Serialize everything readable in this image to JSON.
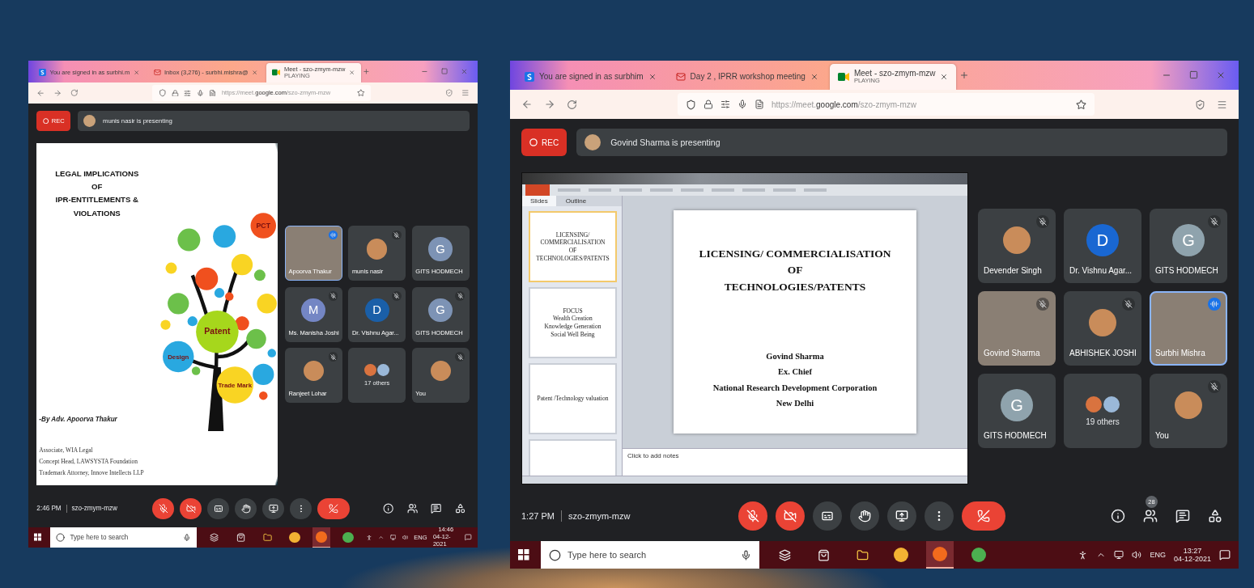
{
  "windows": [
    {
      "tabs": [
        {
          "kind": "s",
          "label": "You are signed in as surbhi.m",
          "selected": false
        },
        {
          "kind": "mail",
          "label": "Inbox (3,276) - surbhi.mishra@",
          "selected": false
        },
        {
          "kind": "meet",
          "label": "Meet - szo-zmym-mzw",
          "sub": "PLAYING",
          "selected": true
        }
      ],
      "url": {
        "prefix": "https://meet.",
        "domain": "google.com",
        "path": "/szo-zmym-mzw"
      },
      "rec": "REC",
      "presenter": "munis nasir is presenting",
      "presentation": {
        "kind": "legal_slide",
        "title": [
          "LEGAL IMPLICATIONS",
          "OF",
          "IPR-ENTITLEMENTS & VIOLATIONS"
        ],
        "byline": "-By Adv. Apoorva Thakur",
        "roles": [
          "Associate, WIA Legal",
          "Concept Head, LAWSYSTA Foundation",
          "Trademark Attorney, Innove Intellects LLP"
        ],
        "bubbles": [
          {
            "label": "Patent",
            "color": "#a6d71c"
          },
          {
            "label": "Design",
            "color": "#29a8e0"
          },
          {
            "label": "Trade Mark",
            "color": "#f9d423"
          },
          {
            "label": "PCT",
            "color": "#f0501e"
          }
        ]
      },
      "tiles": [
        {
          "kind": "video",
          "name": "Apoorva Thakur",
          "muted": false,
          "speaking": true,
          "highlighted": true
        },
        {
          "kind": "avatar",
          "name": "munis nasir",
          "muted": true,
          "speaking": false,
          "highlighted": false
        },
        {
          "kind": "initial",
          "initial": "G",
          "color": "#7d93b5",
          "name": "GITS HODMECH",
          "muted": false,
          "speaking": false,
          "highlighted": false
        },
        {
          "kind": "initial",
          "initial": "M",
          "color": "#7486c4",
          "name": "Ms. Manisha Joshi",
          "muted": true,
          "speaking": false,
          "highlighted": false
        },
        {
          "kind": "initial",
          "initial": "D",
          "color": "#1a5fa8",
          "name": "Dr. Vishnu Agar...",
          "muted": true,
          "speaking": false,
          "highlighted": false
        },
        {
          "kind": "initial",
          "initial": "G",
          "color": "#7d93b5",
          "name": "GITS HODMECH",
          "muted": true,
          "speaking": false,
          "highlighted": false
        },
        {
          "kind": "avatar",
          "name": "Ranjeet Lohar",
          "muted": true,
          "speaking": false,
          "highlighted": false
        },
        {
          "kind": "others",
          "name": "17 others",
          "muted": false,
          "speaking": false,
          "highlighted": false
        },
        {
          "kind": "avatar",
          "name": "You",
          "muted": true,
          "speaking": false,
          "highlighted": false
        }
      ],
      "time": "2:46 PM",
      "code": "szo-zmym-mzw",
      "controls": {
        "mic_on": false,
        "camera_on": false
      },
      "taskbar": {
        "placeholder": "Type here to search",
        "lang": "ENG",
        "time": "14:46",
        "date": "04-12-2021"
      }
    },
    {
      "tabs": [
        {
          "kind": "s",
          "label": "You are signed in as surbhim",
          "selected": false
        },
        {
          "kind": "mail",
          "label": "Day 2 , IPRR workshop meeting",
          "selected": false
        },
        {
          "kind": "meet",
          "label": "Meet - szo-zmym-mzw",
          "sub": "PLAYING",
          "selected": true
        }
      ],
      "url": {
        "prefix": "https://meet.",
        "domain": "google.com",
        "path": "/szo-zmym-mzw"
      },
      "rec": "REC",
      "presenter": "Govind Sharma is presenting",
      "presentation": {
        "kind": "powerpoint",
        "panel_tabs": [
          {
            "label": "Slides",
            "selected": true
          },
          {
            "label": "Outline",
            "selected": false
          }
        ],
        "thumbnails": [
          {
            "lines": [
              "LICENSING/ COMMERCIALISATION",
              "OF",
              "TECHNOLOGIES/PATENTS"
            ],
            "selected": true
          },
          {
            "lines": [
              "FOCUS",
              "Wealth Creation",
              "Knowledge Generation",
              "Social Well Being"
            ],
            "selected": false
          },
          {
            "lines": [
              "Patent /Technology valuation"
            ],
            "selected": false
          },
          {
            "selected": false
          }
        ],
        "title": [
          "LICENSING/ COMMERCIALISATION",
          "OF",
          "TECHNOLOGIES/PATENTS"
        ],
        "details": [
          "Govind Sharma",
          "Ex. Chief",
          "National Research Development Corporation",
          "New Delhi"
        ],
        "notes_placeholder": "Click to add notes"
      },
      "tiles": [
        {
          "kind": "avatar",
          "name": "Devender Singh",
          "muted": true,
          "speaking": false,
          "highlighted": false
        },
        {
          "kind": "initial",
          "initial": "D",
          "color": "#1967d2",
          "name": "Dr. Vishnu Agar...",
          "muted": false,
          "speaking": false,
          "highlighted": false
        },
        {
          "kind": "initial",
          "initial": "G",
          "color": "#8fa3ad",
          "name": "GITS HODMECH",
          "muted": true,
          "speaking": false,
          "highlighted": false
        },
        {
          "kind": "video",
          "name": "Govind Sharma",
          "muted": true,
          "speaking": false,
          "highlighted": false
        },
        {
          "kind": "avatar",
          "name": "ABHISHEK JOSHI",
          "muted": true,
          "speaking": false,
          "highlighted": false
        },
        {
          "kind": "video",
          "name": "Surbhi Mishra",
          "muted": false,
          "speaking": true,
          "highlighted": true
        },
        {
          "kind": "initial",
          "initial": "G",
          "color": "#8fa3ad",
          "name": "GITS HODMECH",
          "muted": false,
          "speaking": false,
          "highlighted": false
        },
        {
          "kind": "others",
          "name": "19 others",
          "muted": false,
          "speaking": false,
          "highlighted": false
        },
        {
          "kind": "avatar",
          "name": "You",
          "muted": true,
          "speaking": false,
          "highlighted": false
        }
      ],
      "time": "1:27 PM",
      "code": "szo-zmym-mzw",
      "people_badge": "28",
      "controls": {
        "mic_on": false,
        "camera_on": false
      },
      "taskbar": {
        "placeholder": "Type here to search",
        "lang": "ENG",
        "time": "13:27",
        "date": "04-12-2021"
      }
    }
  ]
}
